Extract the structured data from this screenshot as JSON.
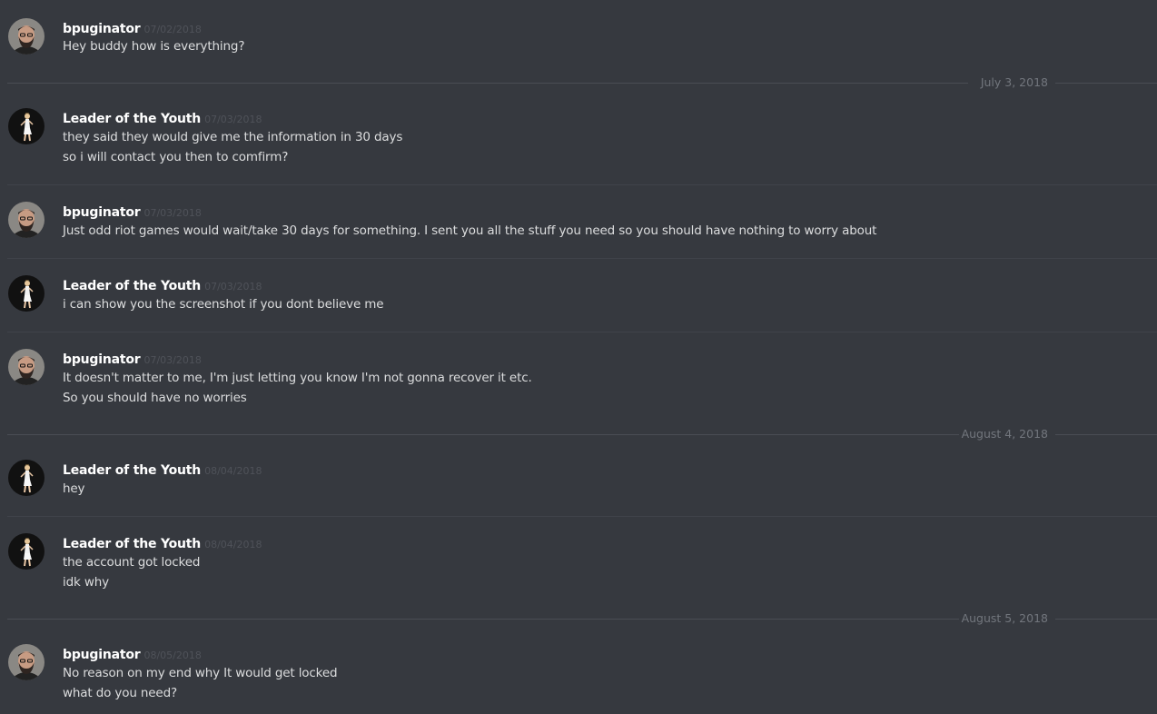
{
  "messages": [
    {
      "author": "bpuginator",
      "avatar": "bearded-man-avatar",
      "timestamp": "07/02/2018",
      "lines": [
        "Hey buddy how is everything?"
      ]
    },
    {
      "author": "Leader of the Youth",
      "avatar": "dancer-avatar",
      "timestamp": "07/03/2018",
      "lines": [
        "they said they would give me the information in 30 days",
        "so i will contact you then to comfirm?"
      ]
    },
    {
      "author": "bpuginator",
      "avatar": "bearded-man-avatar",
      "timestamp": "07/03/2018",
      "lines": [
        "Just odd riot games would wait/take 30 days for something. I sent you all the stuff you need so you should have nothing to worry about"
      ]
    },
    {
      "author": "Leader of the Youth",
      "avatar": "dancer-avatar",
      "timestamp": "07/03/2018",
      "lines": [
        "i can show you the screenshot if you dont believe me"
      ]
    },
    {
      "author": "bpuginator",
      "avatar": "bearded-man-avatar",
      "timestamp": "07/03/2018",
      "lines": [
        "It doesn't matter to me, I'm just letting you know I'm not gonna recover it etc.",
        "So you should have no worries"
      ]
    },
    {
      "author": "Leader of the Youth",
      "avatar": "dancer-avatar",
      "timestamp": "08/04/2018",
      "lines": [
        "hey"
      ]
    },
    {
      "author": "Leader of the Youth",
      "avatar": "dancer-avatar",
      "timestamp": "08/04/2018",
      "lines": [
        "the account got locked",
        "idk why"
      ]
    },
    {
      "author": "bpuginator",
      "avatar": "bearded-man-avatar",
      "timestamp": "08/05/2018",
      "lines": [
        "No reason on my end why It would get locked",
        "what do you need?"
      ]
    }
  ],
  "date_separators": [
    "July 3, 2018",
    "August 4, 2018",
    "August 5, 2018"
  ],
  "colors": {
    "background": "#36393f",
    "username": "#ffffff",
    "message_text": "#dcddde",
    "timestamp": "#4f5259",
    "date_label": "#72767d"
  }
}
